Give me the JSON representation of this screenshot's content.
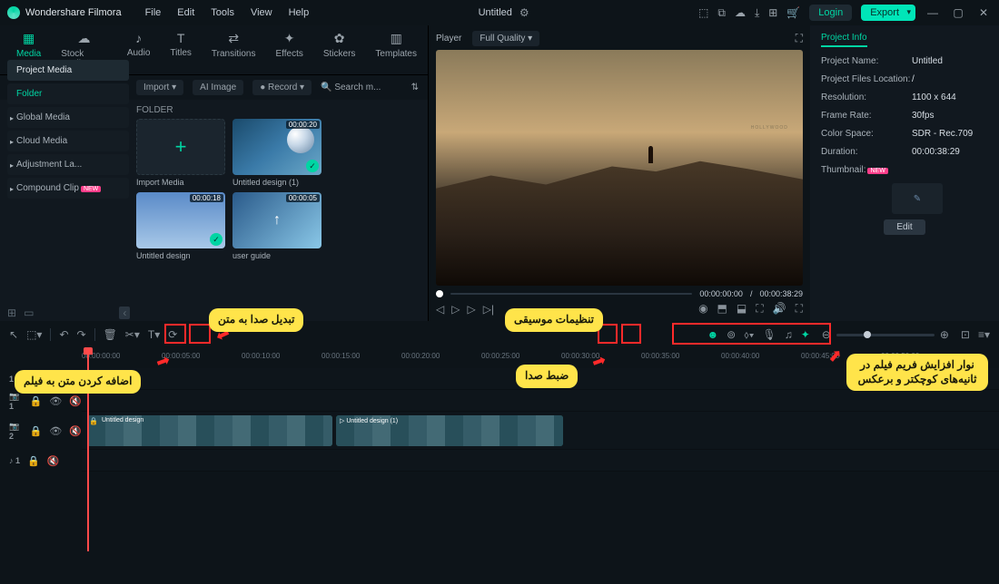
{
  "app": {
    "name": "Wondershare Filmora"
  },
  "menu": [
    "File",
    "Edit",
    "Tools",
    "View",
    "Help"
  ],
  "title": "Untitled",
  "buttons": {
    "login": "Login",
    "export": "Export"
  },
  "mediaTabs": [
    {
      "label": "Media",
      "icon": "▦",
      "active": true
    },
    {
      "label": "Stock Media",
      "icon": "☁",
      "active": false
    },
    {
      "label": "Audio",
      "icon": "♪",
      "active": false
    },
    {
      "label": "Titles",
      "icon": "T",
      "active": false
    },
    {
      "label": "Transitions",
      "icon": "⇄",
      "active": false
    },
    {
      "label": "Effects",
      "icon": "✦",
      "active": false
    },
    {
      "label": "Stickers",
      "icon": "✿",
      "active": false
    },
    {
      "label": "Templates",
      "icon": "▥",
      "active": false
    }
  ],
  "subrow": {
    "import": "Import",
    "aiimage": "AI Image",
    "record": "Record",
    "search": "Search m..."
  },
  "sidebar": [
    {
      "label": "Project Media",
      "sel": true
    },
    {
      "label": "Folder",
      "teal": true
    },
    {
      "label": "Global Media",
      "arr": true
    },
    {
      "label": "Cloud Media",
      "arr": true
    },
    {
      "label": "Adjustment La...",
      "arr": true
    },
    {
      "label": "Compound Clip",
      "arr": true,
      "badge": "NEW"
    }
  ],
  "folderLabel": "FOLDER",
  "thumbs": [
    {
      "type": "import",
      "label": "Import Media"
    },
    {
      "type": "img1",
      "label": "Untitled design (1)",
      "dur": "00:00:20",
      "chk": true
    },
    {
      "type": "img2",
      "label": "Untitled design",
      "dur": "00:00:18",
      "chk": true
    },
    {
      "type": "img3",
      "label": "user guide",
      "dur": "00:00:05"
    }
  ],
  "player": {
    "label": "Player",
    "quality": "Full Quality",
    "t1": "00:00:00:00",
    "t2": "00:00:38:29",
    "sep": "/"
  },
  "projectInfo": {
    "tab": "Project Info",
    "rows": [
      {
        "k": "Project Name:",
        "v": "Untitled"
      },
      {
        "k": "Project Files Location:",
        "v": "/"
      },
      {
        "k": "Resolution:",
        "v": "1100 x 644"
      },
      {
        "k": "Frame Rate:",
        "v": "30fps"
      },
      {
        "k": "Color Space:",
        "v": "SDR - Rec.709"
      },
      {
        "k": "Duration:",
        "v": "00:00:38:29"
      }
    ],
    "thumbLabel": "Thumbnail:",
    "thumbBadge": "NEW",
    "edit": "Edit"
  },
  "ruler": [
    "00:00:00:00",
    "00:00:05:00",
    "00:00:10:00",
    "00:00:15:00",
    "00:00:20:00",
    "00:00:25:00",
    "00:00:30:00",
    "00:00:35:00",
    "00:00:40:00",
    "00:00:45:00",
    "00:00:50:00"
  ],
  "tracks": {
    "t1": "1",
    "v1": "1",
    "v2": "2",
    "a1": "♪ 1"
  },
  "clips": {
    "c1": "Untitled design",
    "c2": "Untitled design (1)"
  },
  "callouts": {
    "tts": "تبدیل صدا به متن",
    "addtext": "اضافه کردن متن به فیلم",
    "music": "تنظیمات موسیقی",
    "record": "ضبط صدا",
    "zoom": "نوار افزایش فریم فیلم در ثانیه‌های کوچکتر و برعکس"
  }
}
